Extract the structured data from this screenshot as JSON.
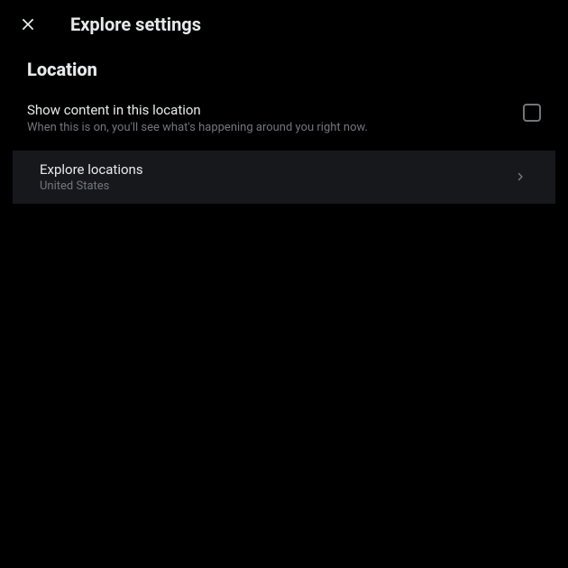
{
  "header": {
    "title": "Explore settings"
  },
  "section": {
    "heading": "Location"
  },
  "setting": {
    "title": "Show content in this location",
    "description": "When this is on, you'll see what's happening around you right now."
  },
  "nav": {
    "title": "Explore locations",
    "subtitle": "United States"
  }
}
